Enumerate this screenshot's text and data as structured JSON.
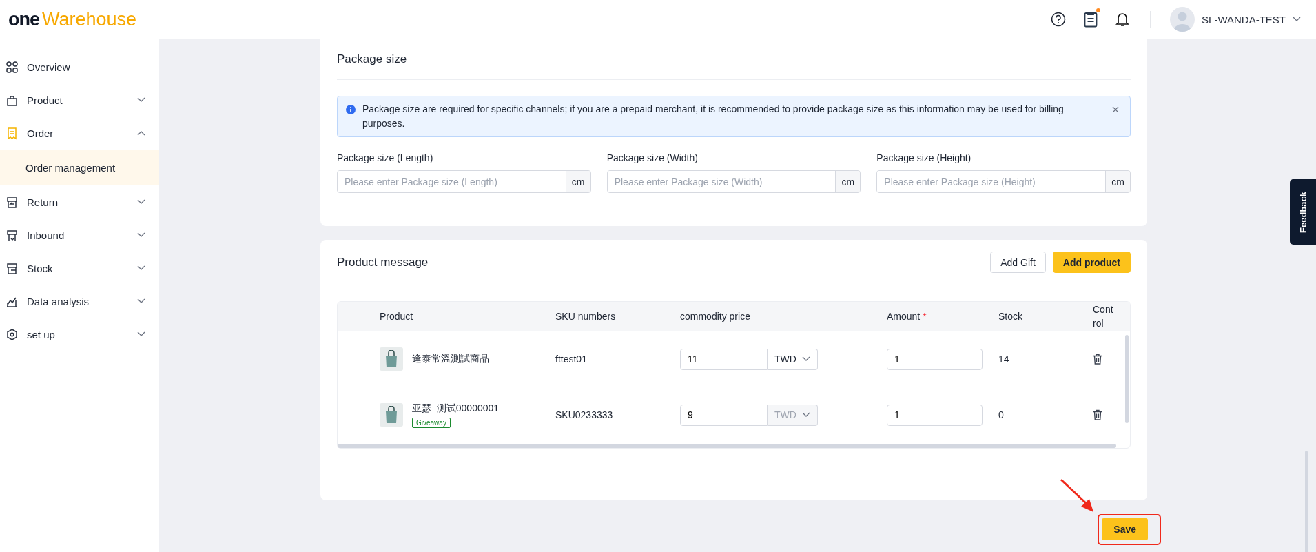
{
  "header": {
    "logo": {
      "part_1": "one",
      "part_2": "Warehouse"
    },
    "tasks_unread": true,
    "user": {
      "name": "SL-WANDA-TEST"
    }
  },
  "sidebar": {
    "items": [
      {
        "label": "Overview",
        "kind": "link",
        "selected": false
      },
      {
        "label": "Product",
        "kind": "group",
        "selected": false,
        "expanded": false
      },
      {
        "label": "Order",
        "kind": "group",
        "selected": true,
        "expanded": true,
        "children": [
          {
            "label": "Order management",
            "selected": true
          }
        ]
      },
      {
        "label": "Return",
        "kind": "group",
        "selected": false,
        "expanded": false
      },
      {
        "label": "Inbound",
        "kind": "group",
        "selected": false,
        "expanded": false
      },
      {
        "label": "Stock",
        "kind": "group",
        "selected": false,
        "expanded": false
      },
      {
        "label": "Data analysis",
        "kind": "group",
        "selected": false,
        "expanded": false
      },
      {
        "label": "set up",
        "kind": "group",
        "selected": false,
        "expanded": false
      }
    ]
  },
  "package_size": {
    "title": "Package size",
    "alert": {
      "message": "Package size are required for specific channels; if you are a prepaid merchant, it is recommended to provide package size as this information may be used for billing purposes."
    },
    "fields": [
      {
        "label": "Package size (Length)",
        "placeholder": "Please enter Package size (Length)",
        "unit": "cm"
      },
      {
        "label": "Package size (Width)",
        "placeholder": "Please enter Package size (Width)",
        "unit": "cm"
      },
      {
        "label": "Package size (Height)",
        "placeholder": "Please enter Package size (Height)",
        "unit": "cm"
      }
    ]
  },
  "product_message": {
    "title": "Product message",
    "buttons": [
      {
        "label": "Add Gift",
        "kind": "secondary"
      },
      {
        "label": "Add product",
        "kind": "primary"
      }
    ],
    "table": {
      "columns": [
        {
          "label": "Product"
        },
        {
          "label": "SKU numbers"
        },
        {
          "label": "commodity price"
        },
        {
          "label": "Amount",
          "required_mark": "*"
        },
        {
          "label": "Stock"
        },
        {
          "label": "Control"
        }
      ],
      "rows": [
        {
          "product": "逢泰常溫測試商品",
          "sku": "fttest01",
          "price": "11",
          "currency": "TWD",
          "currency_disabled": false,
          "amount": "1",
          "stock": "14"
        },
        {
          "product": "亚瑟_测试00000001",
          "tag": "Giveaway",
          "sku": "SKU0233333",
          "price": "9",
          "currency": "TWD",
          "currency_disabled": true,
          "amount": "1",
          "stock": "0"
        }
      ]
    }
  },
  "save_button": {
    "label": "Save"
  },
  "feedback_tab": {
    "label": "Feedback"
  }
}
